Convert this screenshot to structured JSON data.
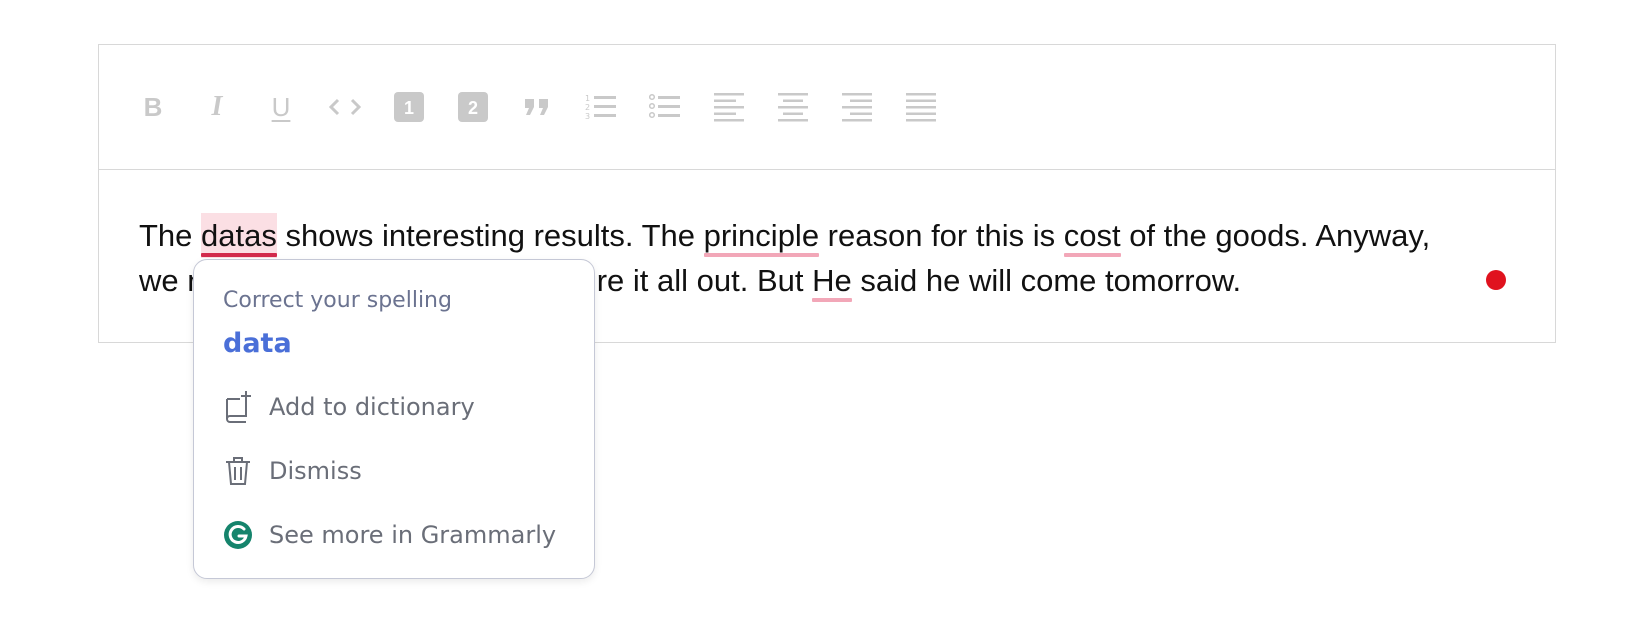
{
  "toolbar": {
    "buttons": [
      {
        "name": "bold-button",
        "icon": "bold-icon",
        "glyph": "B"
      },
      {
        "name": "italic-button",
        "icon": "italic-icon",
        "glyph": "I"
      },
      {
        "name": "underline-button",
        "icon": "underline-icon",
        "glyph": "U"
      },
      {
        "name": "code-button",
        "icon": "code-icon",
        "glyph": "<>"
      },
      {
        "name": "heading-1-button",
        "icon": "heading-1-icon",
        "glyph": "1"
      },
      {
        "name": "heading-2-button",
        "icon": "heading-2-icon",
        "glyph": "2"
      },
      {
        "name": "blockquote-button",
        "icon": "quote-icon",
        "glyph": "❞"
      },
      {
        "name": "ordered-list-button",
        "icon": "ordered-list-icon"
      },
      {
        "name": "bullet-list-button",
        "icon": "bullet-list-icon"
      },
      {
        "name": "align-left-button",
        "icon": "align-left-icon"
      },
      {
        "name": "align-center-button",
        "icon": "align-center-icon"
      },
      {
        "name": "align-right-button",
        "icon": "align-right-icon"
      },
      {
        "name": "align-justify-button",
        "icon": "align-justify-icon"
      }
    ],
    "icon_color": "#c9c9c9"
  },
  "content": {
    "line1": {
      "t1": "The ",
      "e1": "datas",
      "t2": " shows interesting results. The ",
      "e2": "principle",
      "t3": " reason for this is ",
      "e3": "cost",
      "t4": " of the goods. Anyway,"
    },
    "line2": {
      "t1": "we n",
      "t2": "ure it all out. But ",
      "e1": "He",
      "t3": " said he will come tomorrow."
    }
  },
  "status": {
    "icon": "grammarly-status-dot-icon",
    "color": "#e0121e"
  },
  "popup": {
    "heading": "Correct your spelling",
    "suggestion": "data",
    "items": [
      {
        "label": "Add to dictionary",
        "icon": "add-to-dictionary-icon"
      },
      {
        "label": "Dismiss",
        "icon": "trash-icon"
      },
      {
        "label": "See more in Grammarly",
        "icon": "grammarly-logo-icon"
      }
    ],
    "colors": {
      "suggestion": "#4a6fd8",
      "grammarly": "#15846c",
      "error_underline": "#d22a4c"
    }
  }
}
